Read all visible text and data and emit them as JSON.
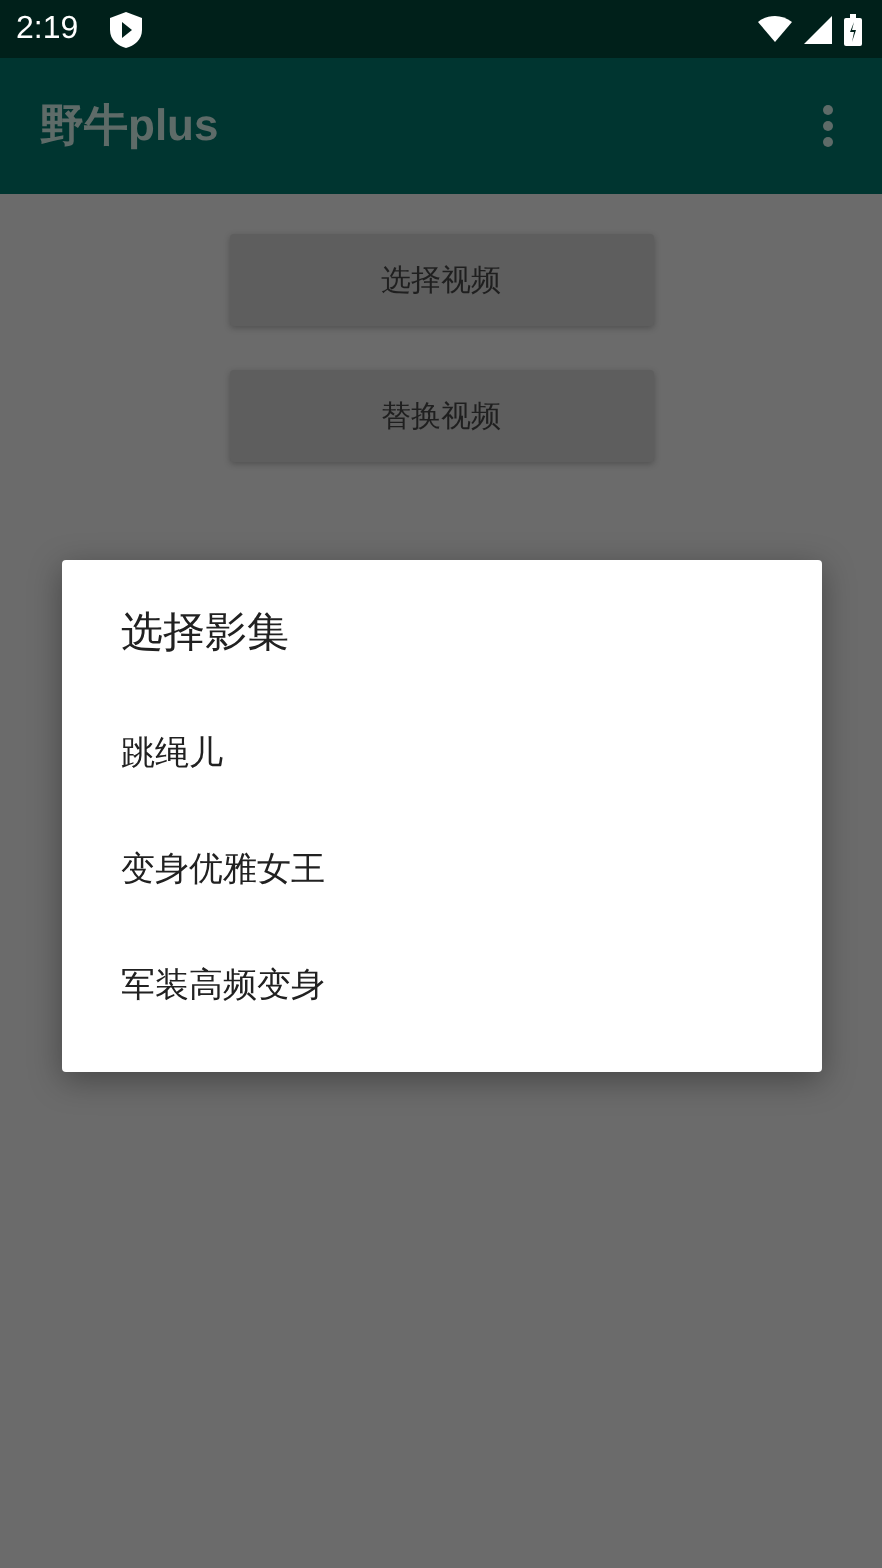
{
  "status_bar": {
    "time": "2:19"
  },
  "app_bar": {
    "title": "野牛plus"
  },
  "buttons": [
    "选择视频",
    "替换视频"
  ],
  "dialog": {
    "title": "选择影集",
    "items": [
      "跳绳儿",
      "变身优雅女王",
      "军装高频变身"
    ]
  }
}
